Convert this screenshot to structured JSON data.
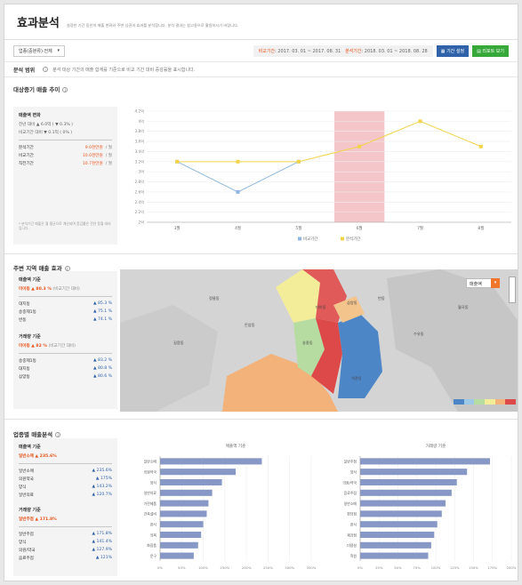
{
  "header": {
    "title": "효과분석",
    "subtitle": "설정한 기간 동안의 매출 변화와 주변 상권의 효과를 분석합니다. 분석 결과는 참고용으로 활용하시기 바랍니다."
  },
  "filter": {
    "selected": "업종(중분류)·전체",
    "period_label": "비교기간",
    "period_value": ": 2017. 03. 01 ~ 2017. 08. 31",
    "analysis_label": "분석기간",
    "analysis_value": ": 2018. 03. 01 ~ 2018. 08. 28",
    "btn_period": "기간 설정",
    "btn_report": "리포트 보기"
  },
  "notice": {
    "label": "분석 범위",
    "text": "분석 대상 기간의 매출 합계를 기준으로 비교 기간 대비 증감률을 표시합니다."
  },
  "trend": {
    "title": "대상중기 매출 추이",
    "panel": {
      "head": "매출액 변화",
      "line1": "전년 대비 ▲ 6.0억 ( ▼ 0.3% )",
      "line2": "비교기간 대비 ▼ 0.1억 ( 0% )",
      "rows": [
        {
          "k": "분석기간",
          "v": "9.0천만원",
          "u": "/ 월"
        },
        {
          "k": "비교기간",
          "v": "10.0천만원",
          "u": "/ 월"
        },
        {
          "k": "직전기간",
          "v": "10.7천만원",
          "u": "/ 월"
        }
      ],
      "foot": "* 분석기간 매출은 월 평균으로 계산되며 증감률은 전년 동월 대비입니다."
    }
  },
  "region": {
    "title": "주변 지역 매출 효과",
    "panel": {
      "head1": "매출액 기준",
      "hl1": "미아동 ▲ 80.3 %",
      "hl1_note": "(비교기간 대비)",
      "rows1": [
        {
          "k": "대지동",
          "v": "▲ 85.3 %"
        },
        {
          "k": "송중제1동",
          "v": "▲ 75.1 %"
        },
        {
          "k": "번동",
          "v": "▲ 74.1 %"
        }
      ],
      "head2": "거래량 기준",
      "hl2": "미아동 ▲ 82 %",
      "hl2_note": "(비교기간 대비)",
      "rows2": [
        {
          "k": "송중제1동",
          "v": "▲ 83.2 %"
        },
        {
          "k": "대지동",
          "v": "▲ 80.8 %"
        },
        {
          "k": "삼양동",
          "v": "▲ 80.6 %"
        }
      ]
    },
    "map_select": "매출액",
    "map_labels": [
      "미아동",
      "삼양동",
      "송중동",
      "번동",
      "수유동",
      "길음동",
      "돈암동",
      "정릉동",
      "월곡동",
      "석관동"
    ]
  },
  "industry": {
    "title": "업종별 매출분석",
    "panel": {
      "head1": "매출액 기준",
      "hl1": "일반소매 ▲ 235.6%",
      "rows1": [
        {
          "k": "일반소매",
          "v": "▲ 235.6%"
        },
        {
          "k": "의원약국",
          "v": "▲ 175%"
        },
        {
          "k": "양식",
          "v": "▲ 143.2%"
        },
        {
          "k": "일반의료",
          "v": "▲ 120.7%"
        }
      ],
      "head2": "거래량 기준",
      "hl2": "일반주점 ▲ 171.8%",
      "rows2": [
        {
          "k": "일반주점",
          "v": "▲ 171.8%"
        },
        {
          "k": "양식",
          "v": "▲ 141.4%"
        },
        {
          "k": "의원/약국",
          "v": "▲ 127.9%"
        },
        {
          "k": "음료주점",
          "v": "▲ 121%"
        }
      ]
    }
  },
  "chart_data": [
    {
      "type": "line",
      "categories": [
        "3월",
        "4월",
        "5월",
        "6월",
        "7월",
        "8월"
      ],
      "y_ticks": [
        "2억",
        "2.2억",
        "2.4억",
        "2.6억",
        "2.8억",
        "3억",
        "3.2억",
        "3.4억",
        "3.6억",
        "3.8억",
        "4억",
        "4.2억"
      ],
      "ylim": [
        2.0,
        4.2
      ],
      "highlight_category": "6월",
      "series": [
        {
          "name": "비교기간",
          "color": "#8fb6e0",
          "values": [
            3.2,
            2.6,
            3.2,
            null,
            null,
            null
          ]
        },
        {
          "name": "분석기간",
          "color": "#f2d44b",
          "values": [
            3.2,
            3.2,
            3.2,
            3.5,
            4.0,
            3.5
          ]
        }
      ],
      "legend": "bottom"
    },
    {
      "type": "bar",
      "orientation": "horizontal",
      "title": "매출액 기준",
      "categories": [
        "일반소매",
        "의원약국",
        "양식",
        "일반의료",
        "가전제품",
        "건축설비",
        "한식",
        "의복",
        "화장품",
        "문구"
      ],
      "values": [
        235.6,
        175,
        143.2,
        120.7,
        112,
        108,
        100,
        95,
        88,
        78
      ],
      "xlim": [
        0,
        350
      ],
      "x_ticks": [
        "0%",
        "50%",
        "100%",
        "150%",
        "200%",
        "250%",
        "300%",
        "350%"
      ],
      "color": "#8797c6"
    },
    {
      "type": "bar",
      "orientation": "horizontal",
      "title": "거래량 기준",
      "categories": [
        "일반주점",
        "양식",
        "의원/약국",
        "음료주점",
        "일반소매",
        "편의점",
        "한식",
        "제과점",
        "미용실",
        "학원"
      ],
      "values": [
        171.8,
        141.4,
        127.9,
        121,
        113,
        108,
        102,
        98,
        94,
        90
      ],
      "xlim": [
        0,
        200
      ],
      "x_ticks": [
        "0%",
        "25%",
        "50%",
        "75%",
        "100%",
        "125%",
        "150%",
        "175%",
        "200%"
      ],
      "color": "#8797c6"
    }
  ]
}
